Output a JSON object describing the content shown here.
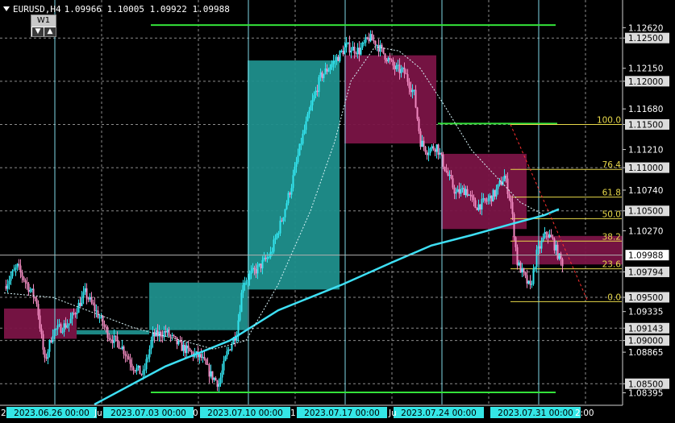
{
  "header": {
    "symbol": "EURUSD,H4",
    "ohlc": "1.09966 1.10005 1.09922 1.09988"
  },
  "widget": {
    "timeframe": "W1",
    "down_glyph": "▼",
    "up_glyph": "▲"
  },
  "colors": {
    "background": "#000000",
    "grid": "#8c8c8c",
    "vertical_line": "#7fd8e6",
    "bull_candle": "#33e5f0",
    "bear_candle": "#f08ac0",
    "bull_zone": "#1f8f8c",
    "bear_zone": "#7a1446",
    "moving_average": "#3ee0f5",
    "fib_line": "#e7d84a",
    "level_line": "#34e23a"
  },
  "price_axis": {
    "min": 1.0826,
    "max": 1.1294,
    "labels": [
      {
        "text": "1.12620",
        "price": 1.1262,
        "boxed": false
      },
      {
        "text": "1.12500",
        "price": 1.125,
        "boxed": true
      },
      {
        "text": "1.12150",
        "price": 1.1215,
        "boxed": false
      },
      {
        "text": "1.12000",
        "price": 1.12,
        "boxed": true
      },
      {
        "text": "1.11680",
        "price": 1.1168,
        "boxed": false
      },
      {
        "text": "1.11500",
        "price": 1.115,
        "boxed": true
      },
      {
        "text": "1.11210",
        "price": 1.1121,
        "boxed": false
      },
      {
        "text": "1.11000",
        "price": 1.11,
        "boxed": true
      },
      {
        "text": "1.10740",
        "price": 1.1074,
        "boxed": false
      },
      {
        "text": "1.10500",
        "price": 1.105,
        "boxed": true
      },
      {
        "text": "1.10270",
        "price": 1.1027,
        "boxed": false
      },
      {
        "text": "1.09794",
        "price": 1.09794,
        "boxed": true
      },
      {
        "text": "1.09500",
        "price": 1.095,
        "boxed": true
      },
      {
        "text": "1.09335",
        "price": 1.09335,
        "boxed": false
      },
      {
        "text": "1.09143",
        "price": 1.09143,
        "boxed": true
      },
      {
        "text": "1.09000",
        "price": 1.09,
        "boxed": true
      },
      {
        "text": "1.08865",
        "price": 1.08865,
        "boxed": false
      },
      {
        "text": "1.08500",
        "price": 1.085,
        "boxed": true
      },
      {
        "text": "1.08395",
        "price": 1.08395,
        "boxed": false
      }
    ],
    "current_price_label": "1.09988",
    "current_price": 1.09988,
    "grid_prices": [
      1.125,
      1.12,
      1.115,
      1.11,
      1.105,
      1.09794,
      1.095,
      1.09143,
      1.09,
      1.085
    ]
  },
  "time_axis": {
    "labels": [
      "2023.06.26 00:00",
      "2023.07.03 00:00",
      "2023.07.10 00:00",
      "2023.07.17 00:00",
      "2023.07.24 00:00",
      "2023.07.31 00:00"
    ],
    "fragments": [
      "2",
      "Ju",
      "0",
      "1",
      "Ju",
      "2:00"
    ],
    "separator_slots": [
      60,
      120,
      180,
      240,
      300,
      360
    ]
  },
  "fibonacci": {
    "levels": [
      {
        "label": "100.0",
        "price": 1.115
      },
      {
        "label": "76.4",
        "price": 1.1098
      },
      {
        "label": "61.8",
        "price": 1.1066
      },
      {
        "label": "50.0",
        "price": 1.1041
      },
      {
        "label": "38.2",
        "price": 1.1015
      },
      {
        "label": "23.6",
        "price": 1.0983
      },
      {
        "label": "0.0",
        "price": 1.0945
      }
    ]
  },
  "level_lines": [
    {
      "price": 1.1265,
      "from_slot": 91,
      "to_slot": 342
    },
    {
      "price": 1.084,
      "from_slot": 91,
      "to_slot": 342
    },
    {
      "price": 1.1151,
      "from_slot": 269,
      "to_slot": 343
    }
  ],
  "zones": [
    {
      "kind": "bear",
      "from_slot": 0,
      "to_slot": 45,
      "top": 1.0937,
      "bottom": 1.0902
    },
    {
      "kind": "bull",
      "from_slot": 45,
      "to_slot": 90,
      "top": 1.0912,
      "bottom": 1.0907
    },
    {
      "kind": "bull",
      "from_slot": 90,
      "to_slot": 151,
      "top": 1.0967,
      "bottom": 1.0912
    },
    {
      "kind": "bull",
      "from_slot": 151,
      "to_slot": 208,
      "top": 1.1224,
      "bottom": 1.0959
    },
    {
      "kind": "bear",
      "from_slot": 211,
      "to_slot": 268,
      "top": 1.123,
      "bottom": 1.1128
    },
    {
      "kind": "bear",
      "from_slot": 271,
      "to_slot": 324,
      "top": 1.1116,
      "bottom": 1.1029
    },
    {
      "kind": "bear",
      "from_slot": 315,
      "to_slot": 385,
      "top": 1.1021,
      "bottom": 1.0988
    }
  ],
  "chart_data": {
    "type": "candlestick",
    "symbol": "EURUSD",
    "timeframe": "H4",
    "ylim": [
      1.0826,
      1.1294
    ],
    "anchors": [
      [
        0,
        1.0963
      ],
      [
        8,
        1.0985
      ],
      [
        14,
        1.0965
      ],
      [
        20,
        1.0945
      ],
      [
        25,
        1.0875
      ],
      [
        30,
        1.091
      ],
      [
        40,
        1.092
      ],
      [
        50,
        1.0955
      ],
      [
        58,
        1.093
      ],
      [
        65,
        1.0905
      ],
      [
        72,
        1.0895
      ],
      [
        80,
        1.087
      ],
      [
        86,
        1.086
      ],
      [
        92,
        1.0905
      ],
      [
        100,
        1.091
      ],
      [
        108,
        1.0895
      ],
      [
        116,
        1.0885
      ],
      [
        122,
        1.088
      ],
      [
        128,
        1.086
      ],
      [
        133,
        1.085
      ],
      [
        138,
        1.0885
      ],
      [
        144,
        1.091
      ],
      [
        148,
        1.0968
      ],
      [
        152,
        1.0975
      ],
      [
        158,
        1.0985
      ],
      [
        165,
        1.1
      ],
      [
        172,
        1.104
      ],
      [
        178,
        1.108
      ],
      [
        184,
        1.113
      ],
      [
        190,
        1.117
      ],
      [
        196,
        1.1205
      ],
      [
        204,
        1.1222
      ],
      [
        212,
        1.124
      ],
      [
        220,
        1.1235
      ],
      [
        226,
        1.125
      ],
      [
        230,
        1.1245
      ],
      [
        236,
        1.123
      ],
      [
        242,
        1.1215
      ],
      [
        248,
        1.121
      ],
      [
        254,
        1.1185
      ],
      [
        258,
        1.113
      ],
      [
        262,
        1.112
      ],
      [
        268,
        1.1125
      ],
      [
        274,
        1.1095
      ],
      [
        280,
        1.107
      ],
      [
        286,
        1.1075
      ],
      [
        292,
        1.1055
      ],
      [
        298,
        1.106
      ],
      [
        304,
        1.107
      ],
      [
        310,
        1.109
      ],
      [
        314,
        1.106
      ],
      [
        318,
        1.099
      ],
      [
        322,
        1.0975
      ],
      [
        326,
        1.096
      ],
      [
        330,
        1.1
      ],
      [
        336,
        1.1025
      ],
      [
        340,
        1.1015
      ],
      [
        344,
        1.0995
      ],
      [
        346,
        1.099
      ]
    ],
    "moving_average": [
      [
        56,
        1.0826
      ],
      [
        100,
        1.087
      ],
      [
        140,
        1.09
      ],
      [
        170,
        1.0935
      ],
      [
        210,
        1.0965
      ],
      [
        240,
        1.099
      ],
      [
        265,
        1.101
      ],
      [
        290,
        1.1022
      ],
      [
        315,
        1.1035
      ],
      [
        335,
        1.1045
      ],
      [
        344,
        1.1052
      ]
    ],
    "signal_line": [
      [
        0,
        1.0955
      ],
      [
        30,
        1.095
      ],
      [
        80,
        1.0915
      ],
      [
        130,
        1.089
      ],
      [
        150,
        1.09
      ],
      [
        170,
        1.0965
      ],
      [
        190,
        1.105
      ],
      [
        205,
        1.113
      ],
      [
        215,
        1.12
      ],
      [
        230,
        1.124
      ],
      [
        245,
        1.1235
      ],
      [
        258,
        1.1215
      ],
      [
        272,
        1.1175
      ],
      [
        290,
        1.112
      ],
      [
        305,
        1.109
      ],
      [
        320,
        1.106
      ],
      [
        335,
        1.1045
      ]
    ],
    "trend_line": [
      [
        314,
        1.115
      ],
      [
        362,
        1.0945
      ]
    ],
    "vertical_lines_slots": [
      31,
      151,
      211,
      271,
      331
    ],
    "current_price": 1.09988
  }
}
